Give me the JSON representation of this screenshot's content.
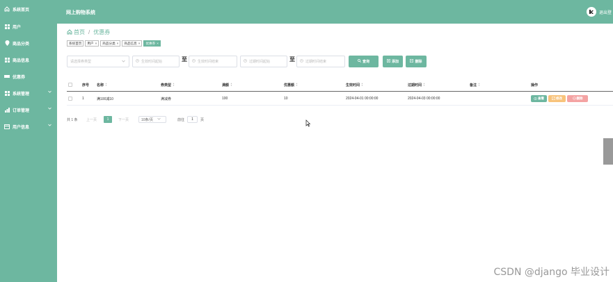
{
  "header": {
    "title": "网上购物系统",
    "logout_label": "退出登"
  },
  "sidebar": {
    "items": [
      {
        "label": "系统首页",
        "icon": "home-icon"
      },
      {
        "label": "用户",
        "icon": "grid-icon"
      },
      {
        "label": "商品分类",
        "icon": "pin-icon"
      },
      {
        "label": "商品信息",
        "icon": "grid-icon"
      },
      {
        "label": "优惠券",
        "icon": "ticket-icon"
      },
      {
        "label": "系统管理",
        "icon": "grid-icon",
        "expandable": true
      },
      {
        "label": "订单管理",
        "icon": "chart-icon",
        "expandable": true
      },
      {
        "label": "用户信息",
        "icon": "card-icon",
        "expandable": true
      }
    ]
  },
  "breadcrumb": {
    "home": "首页",
    "current": "优惠券"
  },
  "tabs": [
    {
      "label": "系统首页",
      "closable": false,
      "active": false
    },
    {
      "label": "用户",
      "closable": true,
      "active": false
    },
    {
      "label": "商品分类",
      "closable": true,
      "active": false
    },
    {
      "label": "商品信息",
      "closable": true,
      "active": false
    },
    {
      "label": "优惠券",
      "closable": true,
      "active": true
    }
  ],
  "filters": {
    "coupon_type_placeholder": "请选择券类型",
    "start_time_begin": "生效时间起始",
    "start_time_end": "生效时间结束",
    "expire_time_begin": "过期时间起始",
    "expire_time_end": "过期时间结束",
    "range_sep": "至",
    "search_label": "查询",
    "add_label": "添加",
    "delete_label": "删除"
  },
  "table": {
    "headers": {
      "index": "序号",
      "name": "名称",
      "type": "券类型",
      "threshold": "满额",
      "discount": "优惠额",
      "start_time": "生效时间",
      "expire_time": "过期时间",
      "remark": "备注",
      "actions": "操作"
    },
    "rows": [
      {
        "index": "1",
        "name": "满100减10",
        "type": "满减券",
        "threshold": "100",
        "discount": "10",
        "start_time": "2024-04-01 00:00:00",
        "expire_time": "2024-04-03 00:00:00",
        "remark": "",
        "view": "查看",
        "edit": "修改",
        "delete": "删除"
      }
    ]
  },
  "pagination": {
    "total": "共 1 条",
    "prev": "上一页",
    "current_page": "1",
    "next": "下一页",
    "page_size": "10条/页",
    "goto_label": "前往",
    "goto_value": "1",
    "page_unit": "页"
  },
  "watermark": "CSDN @django 毕业设计",
  "colors": {
    "primary": "#6db7a0",
    "edit": "#f8c37b",
    "delete": "#f4a3a3"
  }
}
